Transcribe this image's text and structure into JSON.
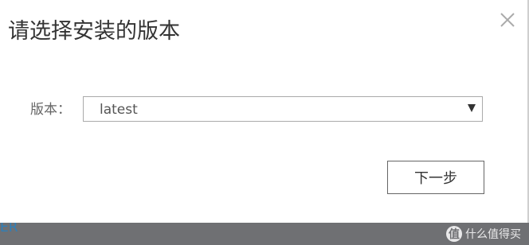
{
  "modal": {
    "title": "请选择安装的版本",
    "close_icon": "close-icon"
  },
  "form": {
    "version_label": "版本：",
    "version_select": {
      "selected": "latest"
    }
  },
  "footer": {
    "next_label": "下一步"
  },
  "backdrop": {
    "partial_text": "ER"
  },
  "watermark": {
    "badge": "值",
    "text": "什么值得买"
  }
}
